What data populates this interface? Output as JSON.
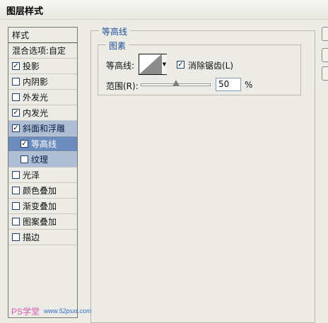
{
  "dialog": {
    "title": "图层样式"
  },
  "style_list": {
    "header": "样式",
    "items": [
      {
        "label": "混合选项:自定",
        "checkbox": false,
        "checked": false,
        "selected": false,
        "indent": false
      },
      {
        "label": "投影",
        "checkbox": true,
        "checked": true,
        "selected": false,
        "indent": false
      },
      {
        "label": "内阴影",
        "checkbox": true,
        "checked": false,
        "selected": false,
        "indent": false
      },
      {
        "label": "外发光",
        "checkbox": true,
        "checked": false,
        "selected": false,
        "indent": false
      },
      {
        "label": "内发光",
        "checkbox": true,
        "checked": true,
        "selected": false,
        "indent": false
      },
      {
        "label": "斜面和浮雕",
        "checkbox": true,
        "checked": true,
        "selected": true,
        "indent": false
      },
      {
        "label": "等高线",
        "checkbox": true,
        "checked": true,
        "selected": true,
        "indent": true
      },
      {
        "label": "纹理",
        "checkbox": true,
        "checked": false,
        "selected": true,
        "indent": true
      },
      {
        "label": "光泽",
        "checkbox": true,
        "checked": false,
        "selected": false,
        "indent": false
      },
      {
        "label": "颜色叠加",
        "checkbox": true,
        "checked": false,
        "selected": false,
        "indent": false
      },
      {
        "label": "渐变叠加",
        "checkbox": true,
        "checked": false,
        "selected": false,
        "indent": false
      },
      {
        "label": "图案叠加",
        "checkbox": true,
        "checked": false,
        "selected": false,
        "indent": false
      },
      {
        "label": "描边",
        "checkbox": true,
        "checked": false,
        "selected": false,
        "indent": false
      }
    ]
  },
  "panel": {
    "group_title": "等高线",
    "subgroup_title": "图素",
    "contour_label": "等高线:",
    "antialias_label": "消除锯齿(L)",
    "antialias_checked": true,
    "range_label": "范围(R):",
    "range_value": "50",
    "range_unit": "%",
    "range_fraction": 0.5
  },
  "watermark": {
    "text_left": "PS学堂",
    "text_right": "www.52psxt.com"
  },
  "colors": {
    "accent": "#1f4f97",
    "selection": "#aebed4",
    "selection_dark": "#6c8cbd"
  },
  "icons": {
    "checkbox": "checkbox-icon",
    "dropdown": "triangle-down-icon",
    "contour": "contour-curve-icon"
  }
}
